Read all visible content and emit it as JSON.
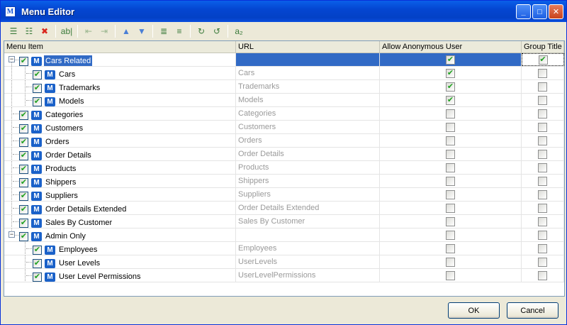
{
  "window": {
    "title": "Menu Editor"
  },
  "toolbar": {
    "tools": [
      {
        "icon": "add-item-icon",
        "glyph": "☰"
      },
      {
        "icon": "add-subitem-icon",
        "glyph": "☷"
      },
      {
        "icon": "delete-icon",
        "glyph": "✖"
      },
      {
        "icon": "rename-icon",
        "glyph": "ab|"
      },
      {
        "icon": "outdent-icon",
        "glyph": "⇤"
      },
      {
        "icon": "indent-icon",
        "glyph": "⇥"
      },
      {
        "icon": "move-up-icon",
        "glyph": "▲"
      },
      {
        "icon": "move-down-icon",
        "glyph": "▼"
      },
      {
        "icon": "expand-all-icon",
        "glyph": "≣"
      },
      {
        "icon": "collapse-all-icon",
        "glyph": "≡"
      },
      {
        "icon": "import-icon",
        "glyph": "↻"
      },
      {
        "icon": "export-icon",
        "glyph": "↺"
      },
      {
        "icon": "translate-icon",
        "glyph": "a₂"
      }
    ]
  },
  "grid": {
    "columns": [
      "Menu Item",
      "URL",
      "Allow Anonymous User",
      "Group Title"
    ],
    "rows": [
      {
        "label": "Cars Related",
        "url": "",
        "level": 0,
        "expander": true,
        "checked": true,
        "anon": true,
        "group": true,
        "selected": true
      },
      {
        "label": "Cars",
        "url": "Cars",
        "level": 1,
        "checked": true,
        "anon": true,
        "group": false
      },
      {
        "label": "Trademarks",
        "url": "Trademarks",
        "level": 1,
        "checked": true,
        "anon": true,
        "group": false
      },
      {
        "label": "Models",
        "url": "Models",
        "level": 1,
        "checked": true,
        "anon": true,
        "group": false
      },
      {
        "label": "Categories",
        "url": "Categories",
        "level": 0,
        "checked": true,
        "anon": false,
        "group": false
      },
      {
        "label": "Customers",
        "url": "Customers",
        "level": 0,
        "checked": true,
        "anon": false,
        "group": false
      },
      {
        "label": "Orders",
        "url": "Orders",
        "level": 0,
        "checked": true,
        "anon": false,
        "group": false
      },
      {
        "label": "Order Details",
        "url": "Order Details",
        "level": 0,
        "checked": true,
        "anon": false,
        "group": false
      },
      {
        "label": "Products",
        "url": "Products",
        "level": 0,
        "checked": true,
        "anon": false,
        "group": false
      },
      {
        "label": "Shippers",
        "url": "Shippers",
        "level": 0,
        "checked": true,
        "anon": false,
        "group": false
      },
      {
        "label": "Suppliers",
        "url": "Suppliers",
        "level": 0,
        "checked": true,
        "anon": false,
        "group": false
      },
      {
        "label": "Order Details Extended",
        "url": "Order Details Extended",
        "level": 0,
        "checked": true,
        "anon": false,
        "group": false
      },
      {
        "label": "Sales By Customer",
        "url": "Sales By Customer",
        "level": 0,
        "checked": true,
        "anon": false,
        "group": false
      },
      {
        "label": "Admin Only",
        "url": "",
        "level": 0,
        "expander": true,
        "checked": true,
        "anon": false,
        "group": false
      },
      {
        "label": "Employees",
        "url": "Employees",
        "level": 1,
        "checked": true,
        "anon": false,
        "group": false
      },
      {
        "label": "User Levels",
        "url": "UserLevels",
        "level": 1,
        "checked": true,
        "anon": false,
        "group": false
      },
      {
        "label": "User Level Permissions",
        "url": "UserLevelPermissions",
        "level": 1,
        "checked": true,
        "anon": false,
        "group": false
      }
    ]
  },
  "buttons": {
    "ok": "OK",
    "cancel": "Cancel"
  },
  "icons": {
    "menu_item": "M",
    "app": "M"
  },
  "colors": {
    "selection": "#316ac5",
    "check": "#21a121",
    "titlebar": "#0446d1"
  }
}
